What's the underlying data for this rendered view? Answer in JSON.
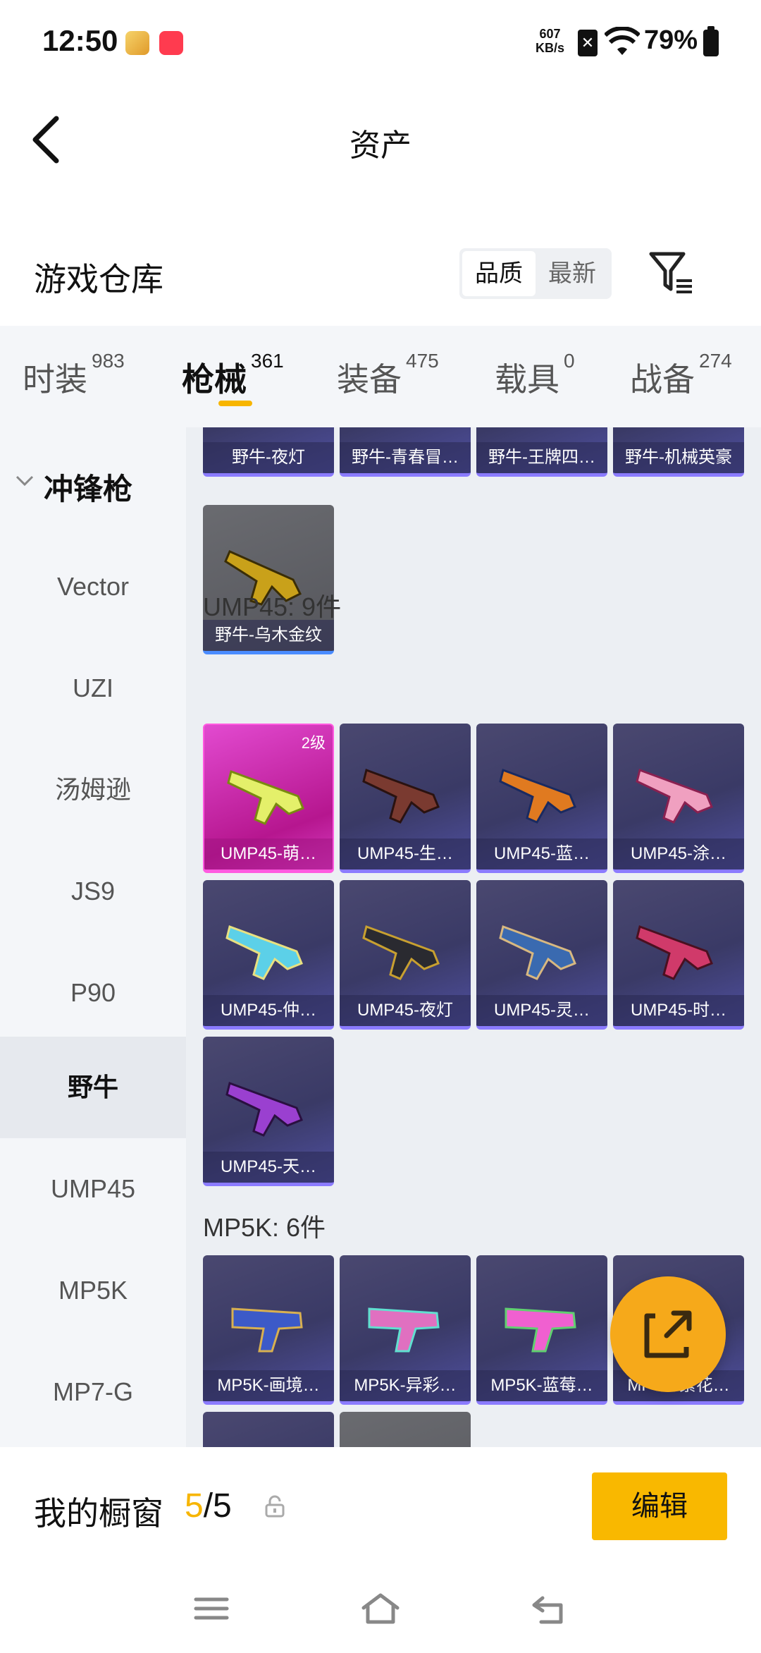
{
  "status_bar": {
    "time": "12:50",
    "net_speed_value": "607",
    "net_speed_unit": "KB/s",
    "battery": "79%"
  },
  "header": {
    "title": "资产"
  },
  "warehouse": {
    "title": "游戏仓库",
    "sort_options": [
      "品质",
      "最新"
    ],
    "active_sort": "品质"
  },
  "tabs": [
    {
      "label": "时装",
      "count": "983"
    },
    {
      "label": "枪械",
      "count": "361"
    },
    {
      "label": "装备",
      "count": "475"
    },
    {
      "label": "载具",
      "count": "0"
    },
    {
      "label": "战备",
      "count": "274"
    }
  ],
  "active_tab": "枪械",
  "sidebar": {
    "group": "冲锋枪",
    "items": [
      "Vector",
      "UZI",
      "汤姆逊",
      "JS9",
      "P90",
      "野牛",
      "UMP45",
      "MP5K",
      "MP7-G"
    ],
    "active": "野牛"
  },
  "content": {
    "bizon_row": [
      "野牛-夜灯",
      "野牛-青春冒…",
      "野牛-王牌四…",
      "野牛-机械英豪"
    ],
    "bizon_extra": [
      "野牛-乌木金纹"
    ],
    "ump_section": "UMP45: 9件",
    "ump_items": [
      {
        "name": "UMP45-萌…",
        "level": "2级"
      },
      {
        "name": "UMP45-生…"
      },
      {
        "name": "UMP45-蓝…"
      },
      {
        "name": "UMP45-涂…"
      },
      {
        "name": "UMP45-仲…"
      },
      {
        "name": "UMP45-夜灯"
      },
      {
        "name": "UMP45-灵…"
      },
      {
        "name": "UMP45-时…"
      },
      {
        "name": "UMP45-天…"
      }
    ],
    "mp5k_section": "MP5K: 6件",
    "mp5k_items": [
      "MP5K-画境…",
      "MP5K-异彩…",
      "MP5K-蓝莓…",
      "MP5K-繁花…"
    ]
  },
  "bottom": {
    "showcase_label": "我的橱窗",
    "showcase_current": "5",
    "showcase_total": "/5",
    "edit_label": "编辑"
  },
  "colors": {
    "accent": "#f7b500",
    "fab": "#f6a91a",
    "card_purple": "#3a3a66",
    "card_pink": "#e24ad0"
  }
}
